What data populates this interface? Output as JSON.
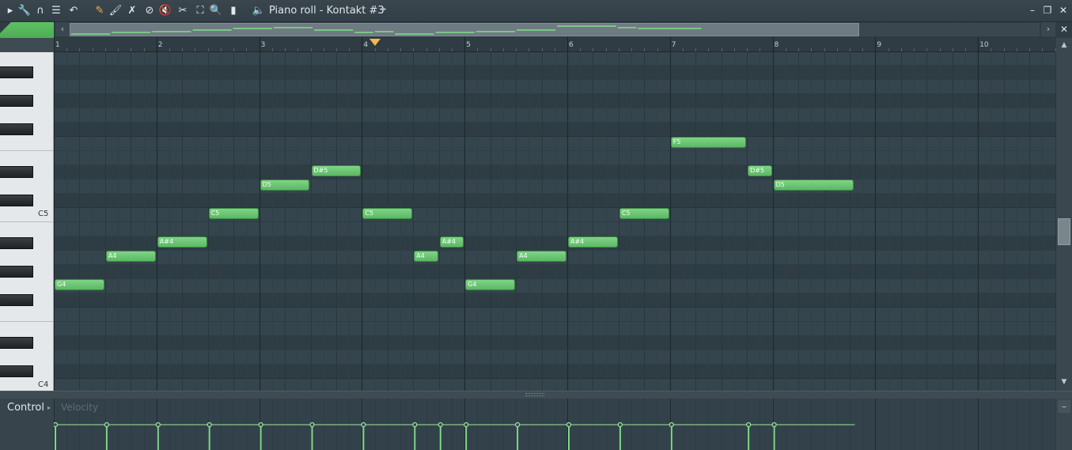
{
  "window": {
    "title": "Piano roll - Kontakt #3",
    "title_arrow": "▸",
    "minimize": "–",
    "restore": "❐",
    "close": "✕"
  },
  "toolbar": {
    "icons": [
      {
        "name": "menu-arrow-icon",
        "glyph": "▸",
        "color": "#e2e8ec"
      },
      {
        "name": "wrench-icon",
        "glyph": "🔧",
        "color": "#e2e8ec"
      },
      {
        "name": "magnet-icon",
        "glyph": "∩",
        "color": "#e2e8ec"
      },
      {
        "name": "menu-lines-icon",
        "glyph": "☰",
        "color": "#e2e8ec"
      },
      {
        "name": "undo-icon",
        "glyph": "↶",
        "color": "#e2e8ec"
      },
      {
        "name": "pencil-icon",
        "glyph": "✎",
        "color": "#f0b24a"
      },
      {
        "name": "brush-icon",
        "glyph": "🖌",
        "color": "#e2e8ec"
      },
      {
        "name": "delete-tool-icon",
        "glyph": "✗",
        "color": "#e2e8ec"
      },
      {
        "name": "mute-tool-icon",
        "glyph": "⊘",
        "color": "#e2e8ec"
      },
      {
        "name": "speaker-mute-icon",
        "glyph": "🔇",
        "color": "#e2e8ec"
      },
      {
        "name": "slice-icon",
        "glyph": "✂",
        "color": "#e2e8ec"
      },
      {
        "name": "select-icon",
        "glyph": "⛶",
        "color": "#e2e8ec"
      },
      {
        "name": "zoom-icon",
        "glyph": "🔍",
        "color": "#e2e8ec"
      },
      {
        "name": "playback-icon",
        "glyph": "▮",
        "color": "#e2e8ec"
      },
      {
        "name": "speaker-icon",
        "glyph": "🔈",
        "color": "#e2e8ec"
      }
    ]
  },
  "overview": {
    "left_arrow": "‹",
    "right_arrow": "›",
    "close": "✕"
  },
  "ruler": {
    "bars": [
      "1",
      "2",
      "3",
      "4",
      "5",
      "6",
      "7",
      "8",
      "9",
      "10"
    ]
  },
  "keyboard": {
    "labels": [
      "C5",
      "C4"
    ]
  },
  "notes": [
    {
      "label": "G4",
      "start": 0,
      "len": 1
    },
    {
      "label": "A4",
      "start": 1,
      "len": 1
    },
    {
      "label": "A#4",
      "start": 2,
      "len": 1
    },
    {
      "label": "C5",
      "start": 3,
      "len": 1
    },
    {
      "label": "D5",
      "start": 4,
      "len": 1
    },
    {
      "label": "D#5",
      "start": 5,
      "len": 1
    },
    {
      "label": "C5",
      "start": 6,
      "len": 1
    },
    {
      "label": "A4",
      "start": 7,
      "len": 0.5
    },
    {
      "label": "A#4",
      "start": 7.5,
      "len": 0.5
    },
    {
      "label": "G4",
      "start": 8,
      "len": 1
    },
    {
      "label": "A4",
      "start": 9,
      "len": 1
    },
    {
      "label": "A#4",
      "start": 10,
      "len": 1
    },
    {
      "label": "C5",
      "start": 11,
      "len": 1
    },
    {
      "label": "F5",
      "start": 12,
      "len": 1.5
    },
    {
      "label": "D#5",
      "start": 13.5,
      "len": 0.5
    },
    {
      "label": "D5",
      "start": 14,
      "len": 1.6
    }
  ],
  "control": {
    "label": "Control",
    "arrow": "▸",
    "velocity_label": "Velocity",
    "minus": "–"
  },
  "colors": {
    "note": "#6cc874",
    "grid_bg": "#33424a",
    "accent": "#f4b84e"
  }
}
